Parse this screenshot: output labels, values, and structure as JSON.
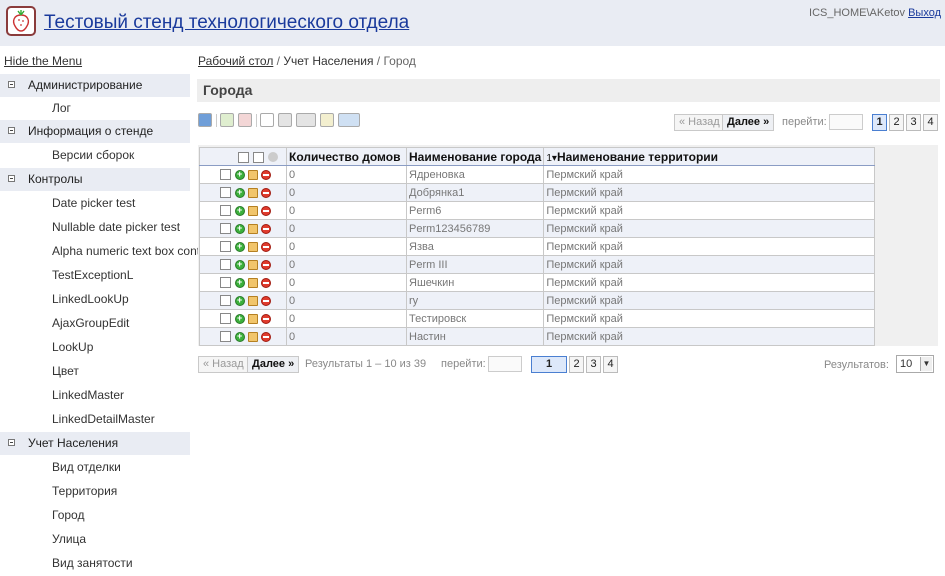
{
  "header": {
    "app_title": "Тестовый стенд технологического отдела",
    "user": "ICS_HOME\\AKetov",
    "logout": "Выход"
  },
  "sidebar": {
    "hide_menu": "Hide the Menu",
    "groups": [
      {
        "label": "Администрирование",
        "items": [
          "Лог"
        ]
      },
      {
        "label": "Информация о стенде",
        "items": [
          "Версии сборок"
        ]
      },
      {
        "label": "Контролы",
        "items": [
          "Date picker test",
          "Nullable date picker test",
          "Alpha numeric text box control",
          "TestExceptionL",
          "LinkedLookUp",
          "AjaxGroupEdit",
          "LookUp",
          "Цвет",
          "LinkedMaster",
          "LinkedDetailMaster"
        ]
      },
      {
        "label": "Учет Населения",
        "items": [
          "Вид отделки",
          "Территория",
          "Город",
          "Улица",
          "Вид занятости"
        ]
      }
    ]
  },
  "breadcrumb": {
    "root": "Рабочий стол",
    "sep": " / ",
    "mid": "Учет Населения",
    "current": "Город"
  },
  "page": {
    "title": "Города"
  },
  "pager": {
    "prev": "« Назад",
    "next": "Далее »",
    "goto": "перейти:",
    "pages": [
      "1",
      "2",
      "3",
      "4"
    ],
    "active_page": "1",
    "results_text": "Результаты 1 – 10 из 39",
    "per_page_label": "Результатов:",
    "per_page_value": "10"
  },
  "grid": {
    "columns": [
      "Количество домов",
      "Наименование города",
      "Наименование территории"
    ],
    "sort_marker": "1▾",
    "rows": [
      [
        "0",
        "Ядреновка",
        "Пермский край"
      ],
      [
        "0",
        "Добрянка1",
        "Пермский край"
      ],
      [
        "0",
        "Perm6",
        "Пермский край"
      ],
      [
        "0",
        "Perm123456789",
        "Пермский край"
      ],
      [
        "0",
        "Язва",
        "Пермский край"
      ],
      [
        "0",
        "Perm III",
        "Пермский край"
      ],
      [
        "0",
        "Яшечкин",
        "Пермский край"
      ],
      [
        "0",
        "ry",
        "Пермский край"
      ],
      [
        "0",
        "Тестировск",
        "Пермский край"
      ],
      [
        "0",
        "Настин",
        "Пермский край"
      ]
    ]
  }
}
